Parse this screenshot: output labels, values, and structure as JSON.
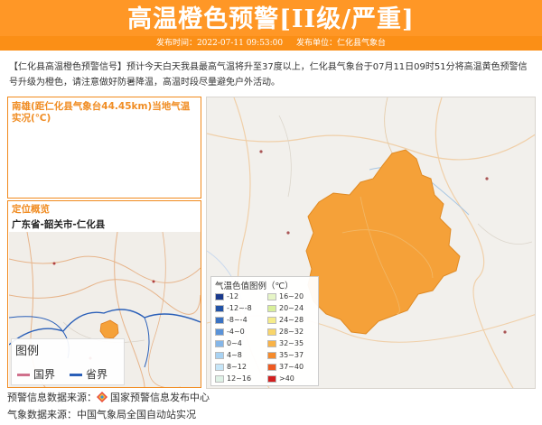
{
  "header": {
    "title": "高温橙色预警[II级/严重]",
    "publish_time": "发布时间：2022-07-11 09:53:00",
    "publisher": "发布单位：仁化县气象台"
  },
  "notice": "【仁化县高温橙色预警信号】预计今天白天我县最高气温将升至37度以上，仁化县气象台于07月11日09时51分将高温黄色预警信号升级为橙色，请注意做好防暑降温，高温时段尽量避免户外活动。",
  "temperature_panel": {
    "title": "南雄(距仁化县气象台44.45km)当地气温实况(℃)"
  },
  "location_panel": {
    "title": "定位概览",
    "region": "广东省-韶关市-仁化县",
    "legend": {
      "title": "图例",
      "items": [
        {
          "label": "国界",
          "color": "#d0708c"
        },
        {
          "label": "省界",
          "color": "#2a5fb8"
        }
      ]
    }
  },
  "temp_legend": {
    "title": "气温色值图例（℃）",
    "left": [
      {
        "label": "-12",
        "color": "#1a3a8c"
      },
      {
        "label": "-12~-8",
        "color": "#2253a6"
      },
      {
        "label": "-8~-4",
        "color": "#3a72c2"
      },
      {
        "label": "-4~0",
        "color": "#5a93d8"
      },
      {
        "label": "0~4",
        "color": "#84b6e8"
      },
      {
        "label": "4~8",
        "color": "#a8d2f2"
      },
      {
        "label": "8~12",
        "color": "#c6e6f8"
      },
      {
        "label": "12~16",
        "color": "#dff2e6"
      }
    ],
    "right": [
      {
        "label": "16~20",
        "color": "#e6f5c6"
      },
      {
        "label": "20~24",
        "color": "#d8ef9a"
      },
      {
        "label": "24~28",
        "color": "#f5ec8a"
      },
      {
        "label": "28~32",
        "color": "#f8d56a"
      },
      {
        "label": "32~35",
        "color": "#f9b347"
      },
      {
        "label": "35~37",
        "color": "#f58a2b"
      },
      {
        "label": "37~40",
        "color": "#ee5a21"
      },
      {
        "label": ">40",
        "color": "#d21f1f"
      }
    ]
  },
  "footer": {
    "warning_source": "预警信息数据来源：",
    "warning_source_name": "国家预警信息发布中心",
    "weather_source": "气象数据来源：中国气象局全国自动站实况"
  },
  "colors": {
    "header_bg": "#ff9726",
    "accent": "#f08d24",
    "warning_area": "#f5a139"
  }
}
